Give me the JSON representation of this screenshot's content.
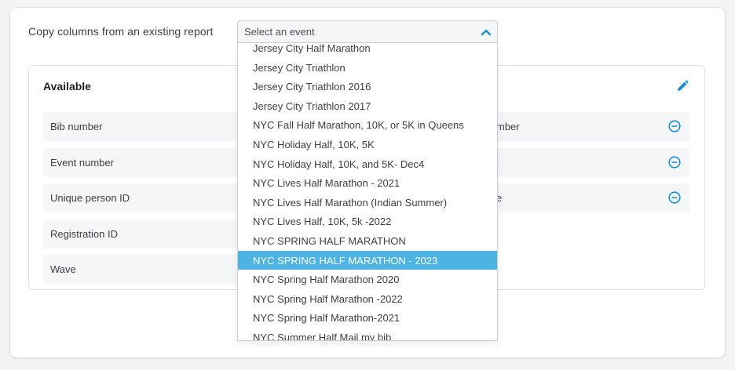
{
  "copy": {
    "label": "Copy columns from an existing report",
    "select_placeholder": "Select an event",
    "chevron_icon": "chevron-up-icon"
  },
  "available": {
    "title": "Available",
    "items": [
      "Bib number",
      "Event number",
      "Unique person ID",
      "Registration ID",
      "Wave"
    ]
  },
  "selected": {
    "items": [
      "mber",
      "",
      "e"
    ],
    "edit_icon": "pencil-icon",
    "remove_icon": "minus-circle-icon"
  },
  "dropdown": {
    "options": [
      "Jersey City Half Marathon",
      "Jersey City Triathlon",
      "Jersey City Triathlon 2016",
      "Jersey City Triathlon 2017",
      "NYC Fall Half Marathon, 10K, or 5K in Queens",
      "NYC Holiday Half, 10K, 5K",
      "NYC Holiday Half, 10K, and 5K- Dec4",
      "NYC Lives Half Marathon - 2021",
      "NYC Lives Half Marathon (Indian Summer)",
      "NYC Lives Half, 10K, 5k -2022",
      "NYC SPRING HALF MARATHON",
      "NYC SPRING HALF MARATHON - 2023",
      "NYC Spring Half Marathon 2020",
      "NYC Spring Half Marathon -2022",
      "NYC Spring Half Marathon-2021",
      "NYC Summer Half Mail my bib"
    ],
    "highlighted": "NYC SPRING HALF MARATHON - 2023"
  },
  "colors": {
    "accent": "#1a8fd0",
    "highlight": "#4db3e3"
  }
}
